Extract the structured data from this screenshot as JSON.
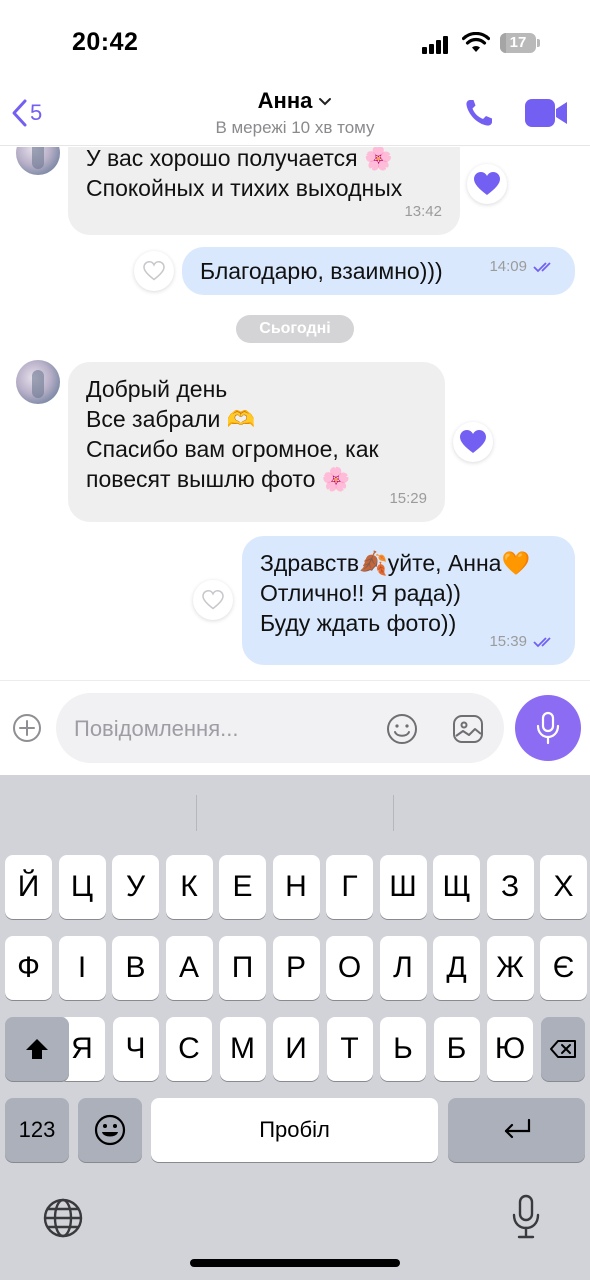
{
  "status_bar": {
    "time": "20:42",
    "battery": "17",
    "battery_level": 0.17
  },
  "header": {
    "back_count": "5",
    "contact_name": "Анна",
    "contact_status": "В мережі 10 хв тому",
    "icons": {
      "back": "chevron-left-icon",
      "name_menu": "chevron-down-icon",
      "call": "phone-icon",
      "video": "video-camera-icon"
    },
    "accent_color": "#7360f2"
  },
  "messages": [
    {
      "direction": "in",
      "lines": [
        "У вас хорошо получается 🌸",
        "Спокойных и тихих выходных"
      ],
      "time": "13:42",
      "reaction": "filled-heart"
    },
    {
      "direction": "out",
      "lines": [
        "Благодарю, взаимно)))"
      ],
      "time": "14:09",
      "reaction": "empty-heart"
    },
    {
      "direction": "in",
      "lines": [
        "Добрый день",
        "Все забрали 🫶",
        "Спасибо вам огромное, как",
        "повесят вышлю фото 🌸"
      ],
      "time": "15:29",
      "reaction": "filled-heart"
    },
    {
      "direction": "out",
      "lines": [
        "Здравств🍂уйте, Анна🧡",
        "Отлично!! Я рада))",
        "Буду ждать фото))"
      ],
      "time": "15:39",
      "reaction": "empty-heart"
    }
  ],
  "date_separator": "Сьогодні",
  "composer": {
    "placeholder": "Повідомлення..."
  },
  "keyboard": {
    "row1": [
      "Й",
      "Ц",
      "У",
      "К",
      "Е",
      "Н",
      "Г",
      "Ш",
      "Щ",
      "З",
      "Х"
    ],
    "row2": [
      "Ф",
      "І",
      "В",
      "А",
      "П",
      "Р",
      "О",
      "Л",
      "Д",
      "Ж",
      "Є"
    ],
    "row3": [
      "Я",
      "Ч",
      "С",
      "М",
      "И",
      "Т",
      "Ь",
      "Б",
      "Ю"
    ],
    "numbers_key": "123",
    "space_key": "Пробіл"
  }
}
